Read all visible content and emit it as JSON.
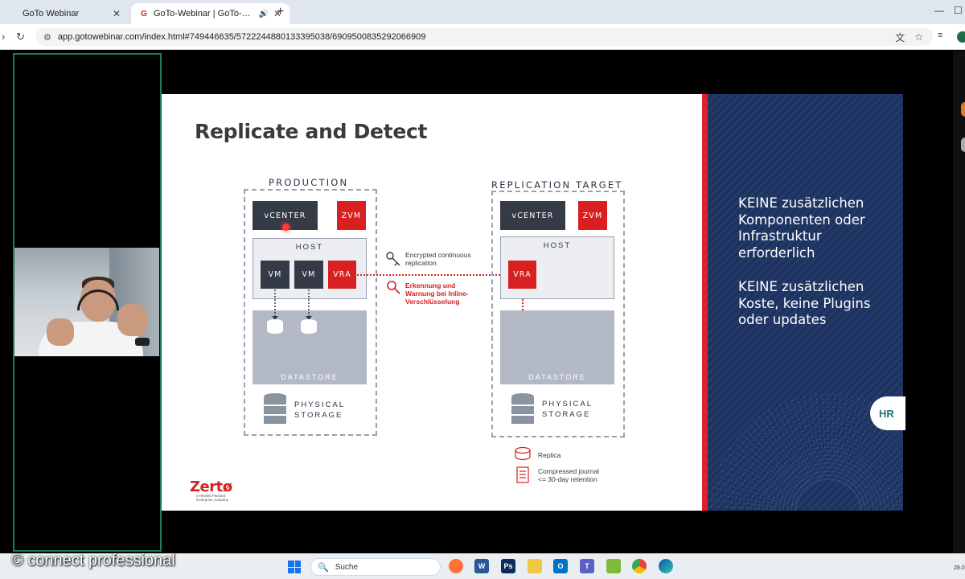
{
  "browser": {
    "tabs": [
      {
        "title": "GoTo Webinar"
      },
      {
        "title": "GoTo-Webinar | GoTo-Webinar"
      }
    ],
    "url": "app.gotowebinar.com/index.html#749446635/5722244880133395038/6909500835292066909"
  },
  "slide": {
    "title": "Replicate and Detect",
    "production": {
      "label": "PRODUCTION",
      "vcenter": "vCENTER",
      "zvm": "ZVM",
      "host": "HOST",
      "vm1": "VM",
      "vm2": "VM",
      "vra": "VRA",
      "datastore": "DATASTORE",
      "physical_line1": "PHYSICAL",
      "physical_line2": "STORAGE"
    },
    "target": {
      "label": "REPLICATION TARGET",
      "vcenter": "vCENTER",
      "zvm": "ZVM",
      "host": "HOST",
      "vra": "VRA",
      "datastore": "DATASTORE",
      "physical_line1": "PHYSICAL",
      "physical_line2": "STORAGE"
    },
    "link_note_1a": "Encrypted continuous",
    "link_note_1b": "replication",
    "link_note_2a": "Erkennung und",
    "link_note_2b": "Warnung bei Inline-",
    "link_note_2c": "Verschlüsselung",
    "legend_replica": "Replica",
    "legend_journal_1": "Compressed journal",
    "legend_journal_2": "<= 30-day retention",
    "brand": "Zertø",
    "brand_sub_1": "a Hewlett Packard",
    "brand_sub_2": "Enterprise company",
    "panel_p1": [
      "KEINE zusätzlichen",
      "Komponenten oder",
      "Infrastruktur",
      "erforderlich"
    ],
    "panel_p2": [
      "KEINE zusätzlichen",
      "Koste, keine Plugins",
      "oder updates"
    ],
    "hr_badge": "HR"
  },
  "watermark": "© connect professional",
  "taskbar": {
    "search_label": "Suche",
    "clock": "28.0"
  },
  "colors": {
    "accent_red": "#d7201f",
    "panel_blue": "#1c3260",
    "speaker_frame": "#1b7b5a"
  }
}
